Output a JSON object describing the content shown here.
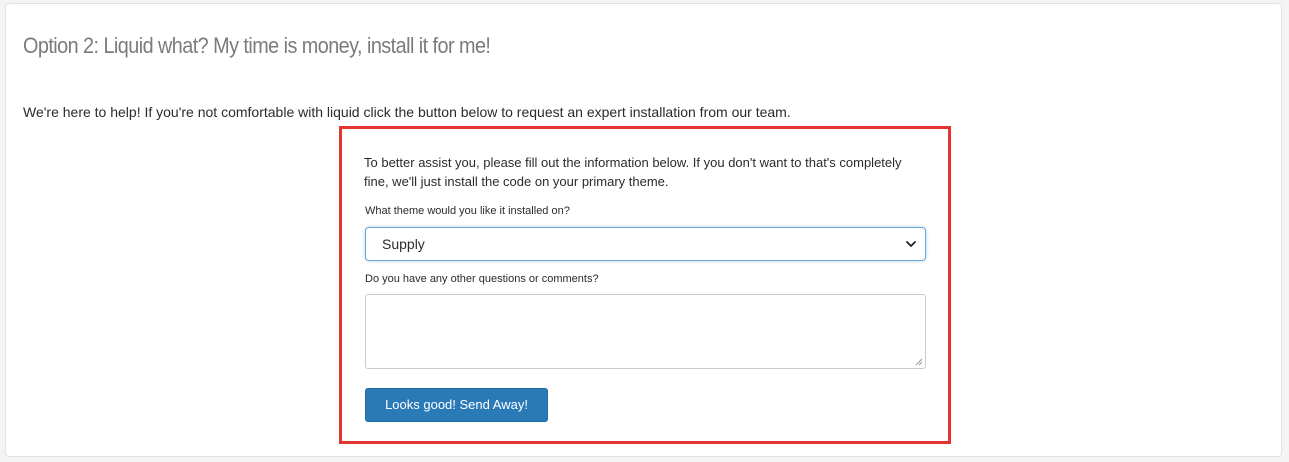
{
  "section": {
    "title": "Option 2: Liquid what? My time is money, install it for me!",
    "intro": "We're here to help! If you're not comfortable with liquid click the button below to request an expert installation from our team."
  },
  "form": {
    "description": "To better assist you, please fill out the information below. If you don't want to that's completely fine, we'll just install the code on your primary theme.",
    "theme_label": "What theme would you like it installed on?",
    "theme_selected": "Supply",
    "comments_label": "Do you have any other questions or comments?",
    "comments_value": "",
    "submit_label": "Looks good! Send Away!"
  },
  "icons": {
    "select_arrow": "chevron-down-icon",
    "textarea_grip": "resize-grip-icon"
  },
  "colors": {
    "highlight_border": "#e3342f",
    "button_bg": "#2a7ab8",
    "title_text": "#7b7b7b",
    "focus_border": "#6aa8d8"
  }
}
